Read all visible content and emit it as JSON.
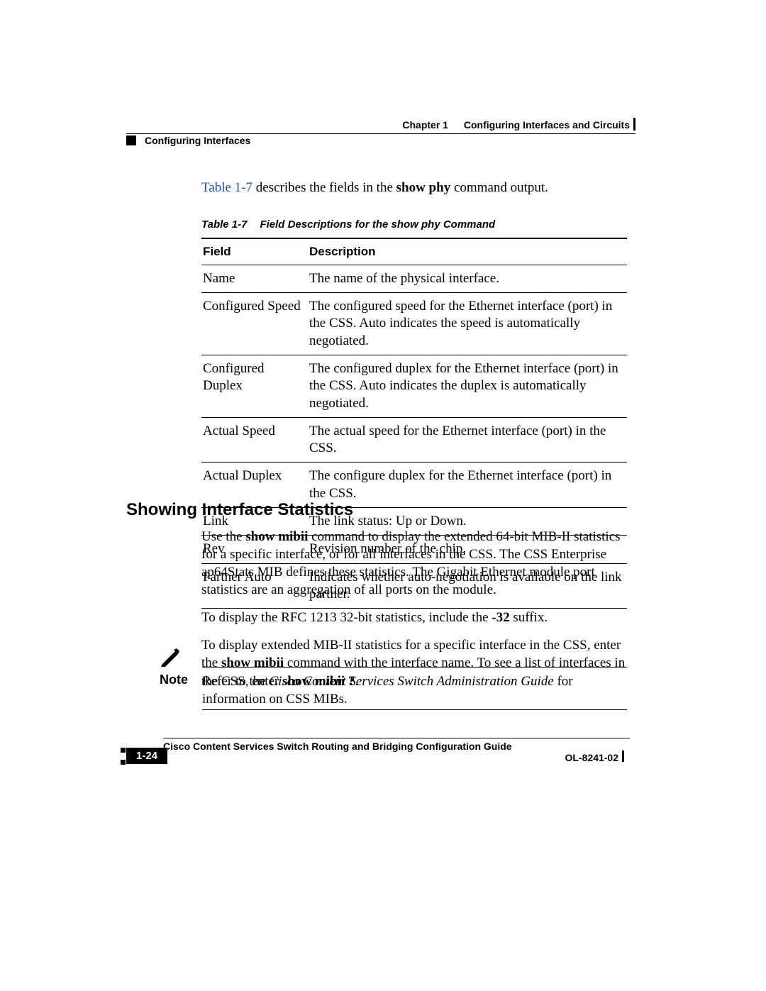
{
  "header": {
    "chapter_label": "Chapter 1",
    "chapter_title": "Configuring Interfaces and Circuits",
    "section_left": "Configuring Interfaces"
  },
  "intro": {
    "link_text": "Table 1-7",
    "rest_1": " describes the fields in the ",
    "bold_cmd": "show phy",
    "rest_2": " command output."
  },
  "table_caption": {
    "label": "Table 1-7",
    "title": "Field Descriptions for the show phy Command"
  },
  "table": {
    "head_field": "Field",
    "head_desc": "Description",
    "rows": [
      {
        "field": "Name",
        "desc": "The name of the physical interface."
      },
      {
        "field": "Configured Speed",
        "desc": "The configured speed for the Ethernet interface (port) in the CSS. Auto indicates the speed is automatically negotiated."
      },
      {
        "field": "Configured Duplex",
        "desc": "The configured duplex for the Ethernet interface (port) in the CSS. Auto indicates the duplex is automatically negotiated."
      },
      {
        "field": "Actual Speed",
        "desc": "The actual speed for the Ethernet interface (port) in the CSS."
      },
      {
        "field": "Actual Duplex",
        "desc": "The configure duplex for the Ethernet interface (port) in the CSS."
      },
      {
        "field": "Link",
        "desc": "The link status: Up or Down."
      },
      {
        "field": "Rev",
        "desc": "Revision number of the chip."
      },
      {
        "field": "Partner Auto",
        "desc": "Indicates whether auto-negotiation is available on the link partner."
      }
    ]
  },
  "section": {
    "heading": "Showing Interface Statistics",
    "p1_a": "Use the ",
    "p1_b": "show mibii",
    "p1_c": " command to display the extended 64-bit MIB-II statistics for a specific interface, or for all interfaces in the CSS. The CSS Enterprise ap64Stats MIB defines these statistics. The Gigabit Ethernet module port statistics are an aggregation of all ports on the module.",
    "p2_a": "To display the RFC 1213 32-bit statistics, include the ",
    "p2_b": "-32",
    "p2_c": " suffix.",
    "p3_a": "To display extended MIB-II statistics for a specific interface in the CSS, enter the ",
    "p3_b": "show mibii",
    "p3_c": " command with the interface name. To see a list of interfaces in the CSS, enter ",
    "p3_d": "show mibii ?",
    "p3_e": "."
  },
  "note": {
    "label": "Note",
    "text_a": "Refer to the ",
    "text_title": "Cisco Content Services Switch Administration Guide",
    "text_b": " for information on CSS MIBs."
  },
  "footer": {
    "guide_title": "Cisco Content Services Switch Routing and Bridging Configuration Guide",
    "page_num": "1-24",
    "doc_id": "OL-8241-02"
  }
}
